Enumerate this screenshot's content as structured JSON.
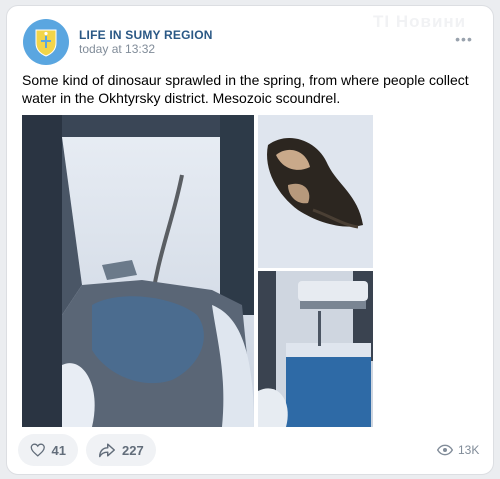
{
  "post": {
    "community_name": "LIFE IN SUMY REGION",
    "time": "today at 13:32",
    "watermark": "TI Новини",
    "more_label": "•••",
    "text": "Some kind of dinosaur sprawled in the spring, from where people collect water in the Okhtyrsky district. Mesozoic scoundrel."
  },
  "actions": {
    "likes": "41",
    "shares": "227",
    "views": "13K"
  },
  "icons": {
    "like": "heart-icon",
    "share": "share-arrow-icon",
    "views": "eye-icon",
    "avatar": "coat-of-arms-icon"
  },
  "colors": {
    "accent": "#2a5885",
    "muted": "#818c99",
    "avatar_bg": "#5aa6e0",
    "button_bg": "#f0f2f5"
  }
}
